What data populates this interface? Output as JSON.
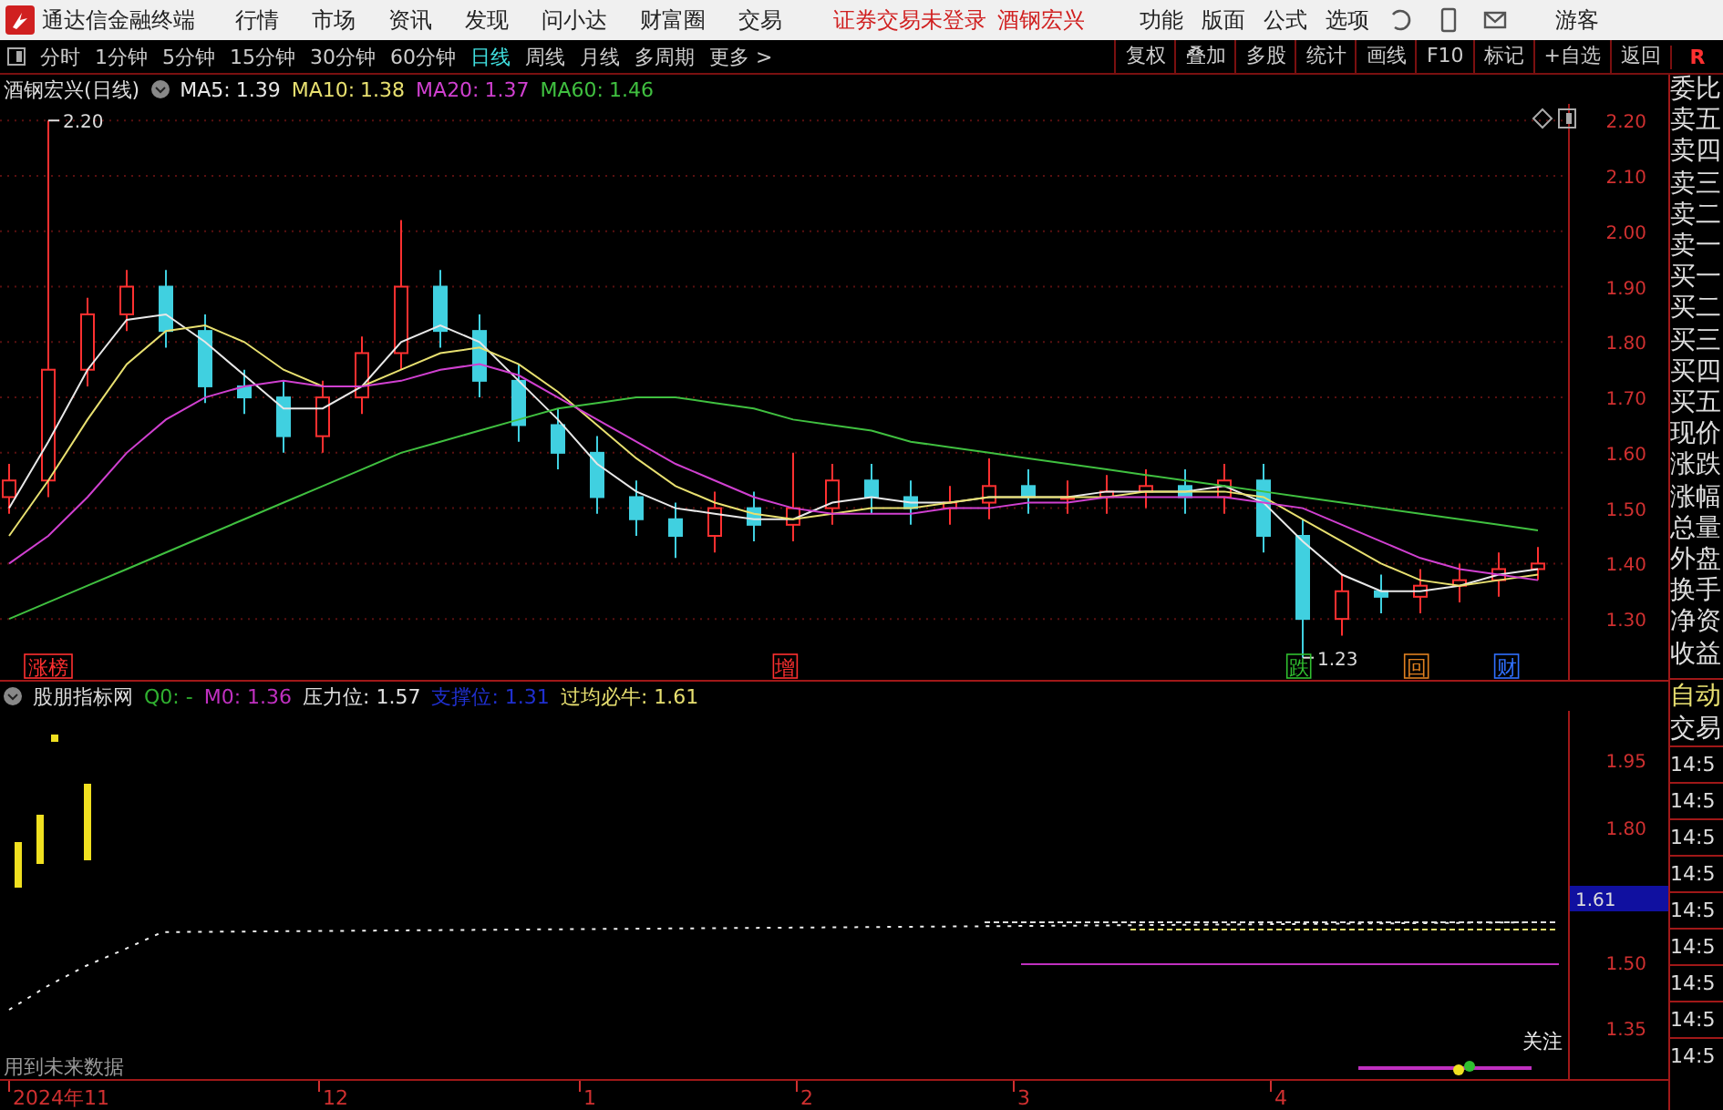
{
  "menu_bar": {
    "app_title": "通达信金融终端",
    "items": [
      "行情",
      "市场",
      "资讯",
      "发现",
      "问小达",
      "财富圈",
      "交易"
    ],
    "status_text": "证券交易未登录",
    "stock_name": "酒钢宏兴",
    "right_items": [
      "功能",
      "版面",
      "公式",
      "选项"
    ],
    "user": "游客"
  },
  "period_tabs": [
    {
      "label": "分时",
      "selected": false
    },
    {
      "label": "1分钟",
      "selected": false
    },
    {
      "label": "5分钟",
      "selected": false
    },
    {
      "label": "15分钟",
      "selected": false
    },
    {
      "label": "30分钟",
      "selected": false
    },
    {
      "label": "60分钟",
      "selected": false
    },
    {
      "label": "日线",
      "selected": true
    },
    {
      "label": "周线",
      "selected": false
    },
    {
      "label": "月线",
      "selected": false
    },
    {
      "label": "多周期",
      "selected": false
    },
    {
      "label": "更多 >",
      "selected": false
    }
  ],
  "tool_buttons": [
    "复权",
    "叠加",
    "多股",
    "统计",
    "画线",
    "F10",
    "标记",
    "+自选",
    "返回"
  ],
  "panel_badge": "R",
  "main_chart": {
    "readings": [
      "1.39",
      "1.38",
      "1.37",
      "1.46"
    ],
    "markers": [
      {
        "text": "涨榜",
        "color": "#ff3030"
      },
      {
        "text": "增",
        "color": "#ff3030"
      },
      {
        "text": "跌",
        "color": "#30c030"
      },
      {
        "text": "回",
        "color": "#e08020"
      },
      {
        "text": "财",
        "color": "#3070ff"
      }
    ],
    "chart_data": {
      "type": "candlestick",
      "title": "酒钢宏兴(日线)",
      "grid": true,
      "ylim": [
        1.19,
        2.23
      ],
      "yticks": [
        {
          "value": 1.3,
          "label": "1.30"
        },
        {
          "value": 1.4,
          "label": "1.40"
        },
        {
          "value": 1.5,
          "label": "1.50"
        },
        {
          "value": 1.6,
          "label": "1.60"
        },
        {
          "value": 1.7,
          "label": "1.70"
        },
        {
          "value": 1.8,
          "label": "1.80"
        },
        {
          "value": 1.9,
          "label": "1.90"
        },
        {
          "value": 2.0,
          "label": "2.00"
        },
        {
          "value": 2.1,
          "label": "2.10"
        },
        {
          "value": 2.2,
          "label": "2.20"
        }
      ],
      "ohlc": [
        [
          1.52,
          1.58,
          1.49,
          1.55
        ],
        [
          1.55,
          2.2,
          1.52,
          1.75
        ],
        [
          1.75,
          1.88,
          1.72,
          1.85
        ],
        [
          1.85,
          1.93,
          1.82,
          1.9
        ],
        [
          1.9,
          1.93,
          1.79,
          1.82
        ],
        [
          1.82,
          1.85,
          1.69,
          1.72
        ],
        [
          1.72,
          1.75,
          1.67,
          1.7
        ],
        [
          1.7,
          1.73,
          1.6,
          1.63
        ],
        [
          1.63,
          1.73,
          1.6,
          1.7
        ],
        [
          1.7,
          1.81,
          1.67,
          1.78
        ],
        [
          1.78,
          2.02,
          1.75,
          1.9
        ],
        [
          1.9,
          1.93,
          1.79,
          1.82
        ],
        [
          1.82,
          1.85,
          1.7,
          1.73
        ],
        [
          1.73,
          1.76,
          1.62,
          1.65
        ],
        [
          1.65,
          1.68,
          1.57,
          1.6
        ],
        [
          1.6,
          1.63,
          1.49,
          1.52
        ],
        [
          1.52,
          1.55,
          1.45,
          1.48
        ],
        [
          1.48,
          1.51,
          1.41,
          1.45
        ],
        [
          1.45,
          1.53,
          1.42,
          1.5
        ],
        [
          1.5,
          1.53,
          1.44,
          1.47
        ],
        [
          1.47,
          1.6,
          1.44,
          1.5
        ],
        [
          1.5,
          1.58,
          1.47,
          1.55
        ],
        [
          1.55,
          1.58,
          1.49,
          1.52
        ],
        [
          1.52,
          1.55,
          1.47,
          1.5
        ],
        [
          1.5,
          1.54,
          1.47,
          1.51
        ],
        [
          1.51,
          1.59,
          1.48,
          1.54
        ],
        [
          1.54,
          1.57,
          1.49,
          1.52
        ],
        [
          1.52,
          1.55,
          1.49,
          1.52
        ],
        [
          1.52,
          1.56,
          1.49,
          1.53
        ],
        [
          1.53,
          1.57,
          1.5,
          1.54
        ],
        [
          1.54,
          1.57,
          1.49,
          1.52
        ],
        [
          1.52,
          1.58,
          1.49,
          1.55
        ],
        [
          1.55,
          1.58,
          1.42,
          1.45
        ],
        [
          1.45,
          1.48,
          1.23,
          1.3
        ],
        [
          1.3,
          1.38,
          1.27,
          1.35
        ],
        [
          1.35,
          1.38,
          1.31,
          1.34
        ],
        [
          1.34,
          1.39,
          1.31,
          1.36
        ],
        [
          1.36,
          1.4,
          1.33,
          1.37
        ],
        [
          1.37,
          1.42,
          1.34,
          1.39
        ],
        [
          1.39,
          1.43,
          1.37,
          1.4
        ]
      ],
      "series": [
        {
          "name": "MA5:",
          "type": "line",
          "color": "#e8e8e8",
          "values": [
            1.5,
            1.62,
            1.75,
            1.84,
            1.85,
            1.8,
            1.74,
            1.68,
            1.68,
            1.72,
            1.8,
            1.83,
            1.8,
            1.73,
            1.66,
            1.58,
            1.53,
            1.5,
            1.49,
            1.48,
            1.48,
            1.51,
            1.52,
            1.51,
            1.51,
            1.52,
            1.52,
            1.52,
            1.53,
            1.53,
            1.53,
            1.54,
            1.51,
            1.44,
            1.38,
            1.35,
            1.35,
            1.36,
            1.38,
            1.39
          ]
        },
        {
          "name": "MA10:",
          "type": "line",
          "color": "#e8e070",
          "values": [
            1.45,
            1.55,
            1.66,
            1.76,
            1.82,
            1.83,
            1.8,
            1.75,
            1.72,
            1.72,
            1.75,
            1.78,
            1.79,
            1.76,
            1.71,
            1.65,
            1.59,
            1.54,
            1.51,
            1.49,
            1.48,
            1.49,
            1.5,
            1.5,
            1.51,
            1.52,
            1.52,
            1.52,
            1.52,
            1.53,
            1.53,
            1.53,
            1.52,
            1.48,
            1.44,
            1.4,
            1.37,
            1.36,
            1.37,
            1.38
          ]
        },
        {
          "name": "MA20:",
          "type": "line",
          "color": "#d040d0",
          "values": [
            1.4,
            1.45,
            1.52,
            1.6,
            1.66,
            1.7,
            1.72,
            1.73,
            1.72,
            1.72,
            1.73,
            1.75,
            1.76,
            1.74,
            1.7,
            1.66,
            1.62,
            1.58,
            1.55,
            1.52,
            1.5,
            1.49,
            1.49,
            1.49,
            1.5,
            1.5,
            1.51,
            1.51,
            1.52,
            1.52,
            1.52,
            1.52,
            1.51,
            1.5,
            1.47,
            1.44,
            1.41,
            1.39,
            1.38,
            1.37
          ]
        },
        {
          "name": "MA60:",
          "type": "line",
          "color": "#40c040",
          "values": [
            1.3,
            1.33,
            1.36,
            1.39,
            1.42,
            1.45,
            1.48,
            1.51,
            1.54,
            1.57,
            1.6,
            1.62,
            1.64,
            1.66,
            1.68,
            1.69,
            1.7,
            1.7,
            1.69,
            1.68,
            1.66,
            1.65,
            1.64,
            1.62,
            1.61,
            1.6,
            1.59,
            1.58,
            1.57,
            1.56,
            1.55,
            1.54,
            1.53,
            1.52,
            1.51,
            1.5,
            1.49,
            1.48,
            1.47,
            1.46
          ]
        }
      ],
      "annotations": [
        "2.20",
        "1.23"
      ]
    }
  },
  "indicator": {
    "name": "股朋指标网",
    "legend": [
      {
        "text": "Q0: -",
        "color": "#30b030"
      },
      {
        "text": "M0: 1.36",
        "color": "#c030c0"
      },
      {
        "text": "压力位: 1.57",
        "color": "#e0e0e0"
      },
      {
        "text": "支撑位: 1.31",
        "color": "#2030d0"
      },
      {
        "text": "过均必牛: 1.61",
        "color": "#e8e070"
      }
    ],
    "axis_labels": [
      "1.95",
      "1.80",
      "1.50",
      "1.35"
    ],
    "current_value": "1.61",
    "tag": "关注",
    "note": "用到未来数据"
  },
  "date_axis": [
    "2024年11",
    "12",
    "1",
    "2",
    "3",
    "4"
  ],
  "quote_panel": {
    "labels": [
      "委比",
      "卖五",
      "卖四",
      "卖三",
      "卖二",
      "卖一",
      "买一",
      "买二",
      "买三",
      "买四",
      "买五",
      "现价",
      "涨跌",
      "涨幅",
      "总量",
      "外盘",
      "换手",
      "净资",
      "收益"
    ],
    "mode": "自动",
    "trade_label": "交易",
    "times": [
      "14:5",
      "14:5",
      "14:5",
      "14:5",
      "14:5",
      "14:5",
      "14:5",
      "14:5",
      "14:5"
    ]
  }
}
